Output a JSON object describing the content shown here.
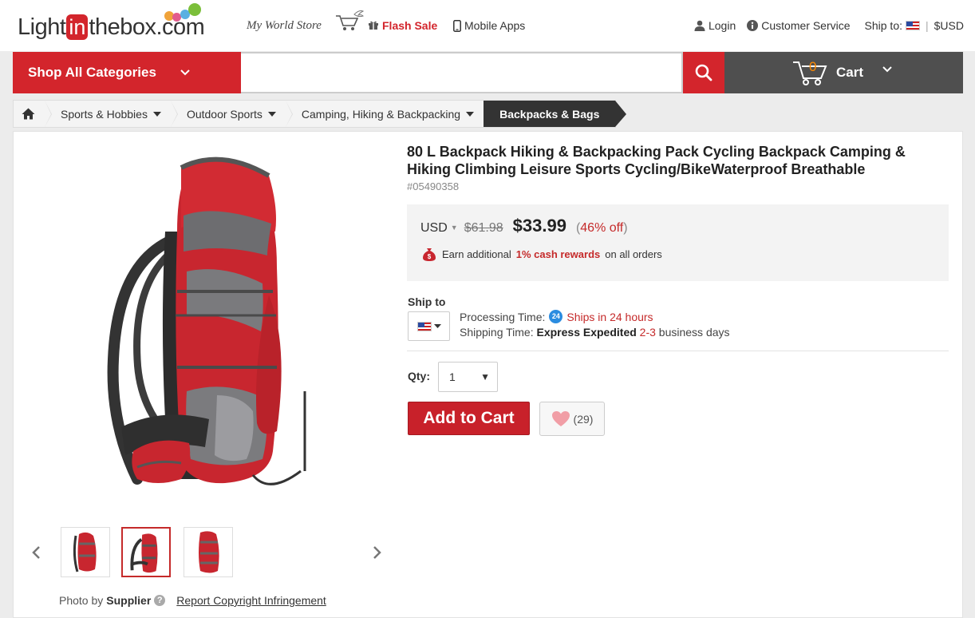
{
  "header": {
    "logo_left": "Light",
    "logo_mid": "in",
    "logo_right": "thebox.com",
    "tagline": "My World Store",
    "flash_sale": "Flash Sale",
    "mobile_apps": "Mobile Apps",
    "login": "Login",
    "customer_service": "Customer Service",
    "ship_to": "Ship to:",
    "currency": "$USD"
  },
  "nav": {
    "shop_all": "Shop All Categories",
    "search_placeholder": "",
    "cart_count": "0",
    "cart_label": "Cart"
  },
  "breadcrumb": [
    {
      "label": "Sports & Hobbies"
    },
    {
      "label": "Outdoor Sports"
    },
    {
      "label": "Camping, Hiking & Backpacking"
    },
    {
      "label": "Backpacks & Bags"
    }
  ],
  "product": {
    "title": "80 L Backpack Hiking & Backpacking Pack Cycling Backpack Camping & Hiking Climbing Leisure Sports Cycling/BikeWaterproof Breathable",
    "sku": "#05490358",
    "currency": "USD",
    "old_price": "$61.98",
    "price": "$33.99",
    "discount": "46% off",
    "cash_pre": "Earn additional",
    "cash_highlight": "1% cash rewards",
    "cash_post": "on all orders"
  },
  "shipping": {
    "label": "Ship to",
    "processing_label": "Processing Time:",
    "processing_value": "Ships in 24 hours",
    "badge": "24",
    "shipping_label": "Shipping Time:",
    "method": "Express Expedited",
    "days": "2-3",
    "days_suffix": "business days"
  },
  "purchase": {
    "qty_label": "Qty:",
    "qty_value": "1",
    "add_to_cart": "Add to Cart",
    "wishlist_count": "(29)"
  },
  "gallery": {
    "photo_by": "Photo by",
    "supplier": "Supplier",
    "help": "?",
    "report": "Report Copyright Infringement",
    "selected_index": 1
  },
  "colors": {
    "brand_red": "#d3252c",
    "nav_grey": "#4f4f4f",
    "cart_orange": "#ff8a00"
  }
}
